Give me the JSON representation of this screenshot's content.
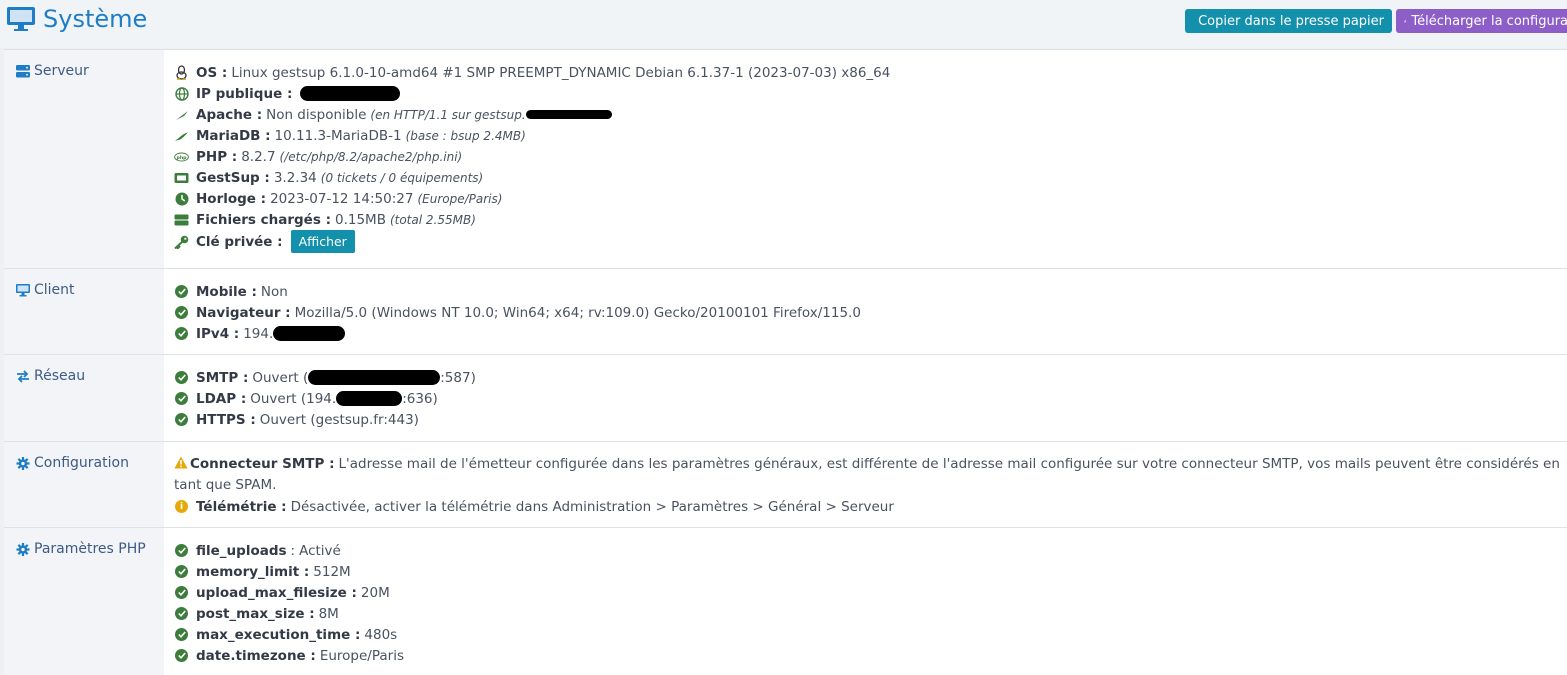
{
  "header": {
    "title": "Système",
    "copy_label": "Copier dans le presse papier",
    "download_label": "Télécharger la configura"
  },
  "colors": {
    "primary": "#1e7dc6",
    "copy_btn": "#1390ab",
    "download_btn": "#8d5ec7",
    "ok": "#3c7d3c",
    "warning": "#e5a90a"
  },
  "server": {
    "label": "Serveur",
    "os_key": "OS :",
    "os_val": "Linux gestsup 6.1.0-10-amd64 #1 SMP PREEMPT_DYNAMIC Debian 6.1.37-1 (2023-07-03) x86_64",
    "ip_key": "IP publique :",
    "apache_key": "Apache :",
    "apache_val": "Non disponible",
    "apache_note": "(en HTTP/1.1 sur gestsup.",
    "mariadb_key": "MariaDB :",
    "mariadb_val": "10.11.3-MariaDB-1",
    "mariadb_note": "(base : bsup 2.4MB)",
    "php_key": "PHP :",
    "php_val": "8.2.7",
    "php_note": "(/etc/php/8.2/apache2/php.ini)",
    "gestsup_key": "GestSup :",
    "gestsup_val": "3.2.34",
    "gestsup_note": "(0 tickets / 0 équipements)",
    "clock_key": "Horloge :",
    "clock_val": "2023-07-12 14:50:27",
    "clock_note": "(Europe/Paris)",
    "files_key": "Fichiers chargés :",
    "files_val": "0.15MB",
    "files_note": "(total 2.55MB)",
    "key_key": "Clé privée :",
    "key_btn": "Afficher"
  },
  "client": {
    "label": "Client",
    "mobile_key": "Mobile :",
    "mobile_val": "Non",
    "browser_key": "Navigateur :",
    "browser_val": "Mozilla/5.0 (Windows NT 10.0; Win64; x64; rv:109.0) Gecko/20100101 Firefox/115.0",
    "ipv4_key": "IPv4 :",
    "ipv4_val": "194."
  },
  "network": {
    "label": "Réseau",
    "smtp_key": "SMTP :",
    "smtp_val": "Ouvert (",
    "smtp_tail": ":587)",
    "ldap_key": "LDAP :",
    "ldap_val": "Ouvert (194.",
    "ldap_tail": ":636)",
    "https_key": "HTTPS :",
    "https_val": "Ouvert (gestsup.fr:443)"
  },
  "config": {
    "label": "Configuration",
    "smtp_key": "Connecteur SMTP :",
    "smtp_val": "L'adresse mail de l'émetteur configurée dans les paramètres généraux, est différente de l'adresse mail configurée sur votre connecteur SMTP, vos mails peuvent être considérés en tant que SPAM.",
    "telemetry_key": "Télémétrie :",
    "telemetry_val": "Désactivée, activer la télémétrie dans Administration > Paramètres > Général > Serveur"
  },
  "php_params": {
    "label": "Paramètres PHP",
    "items": [
      {
        "key": "file_uploads",
        "sep": " : ",
        "bold_sep": false,
        "val": "Activé"
      },
      {
        "key": "memory_limit :",
        "val": "512M"
      },
      {
        "key": "upload_max_filesize :",
        "val": "20M"
      },
      {
        "key": "post_max_size :",
        "val": "8M"
      },
      {
        "key": "max_execution_time :",
        "val": "480s"
      },
      {
        "key": "date.timezone :",
        "val": "Europe/Paris"
      }
    ],
    "file_uploads_sep": ":"
  }
}
